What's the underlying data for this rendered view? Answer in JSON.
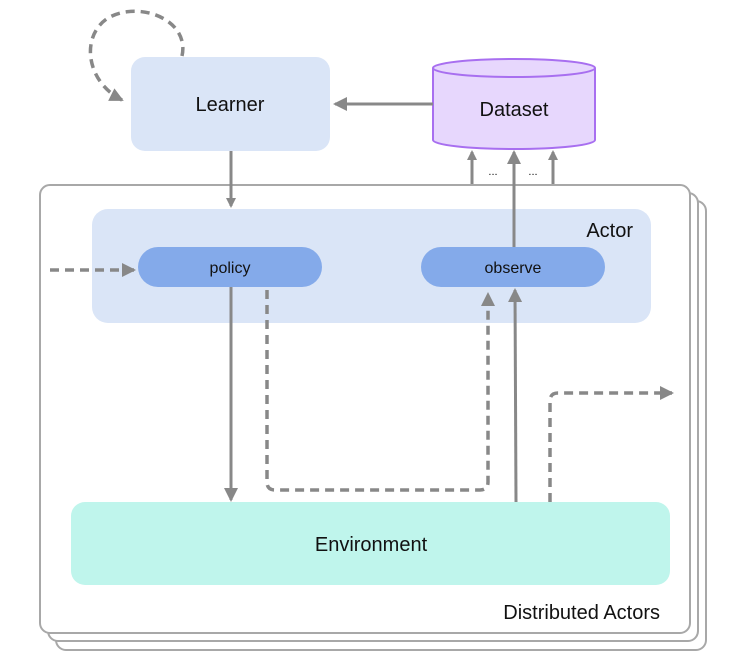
{
  "nodes": {
    "learner": "Learner",
    "dataset": "Dataset",
    "actor": "Actor",
    "policy": "policy",
    "observe": "observe",
    "environment": "Environment",
    "distributed_actors": "Distributed Actors"
  },
  "ellipsis": "...",
  "colors": {
    "learner_fill": "#dae5f7",
    "dataset_fill": "#e7d7fd",
    "dataset_stroke": "#a86ff0",
    "actor_fill": "#dae5f7",
    "pill_fill": "#84aaea",
    "environment_fill": "#bff5ec",
    "arrow": "#888888",
    "frame_stroke": "#a8a8a8"
  }
}
